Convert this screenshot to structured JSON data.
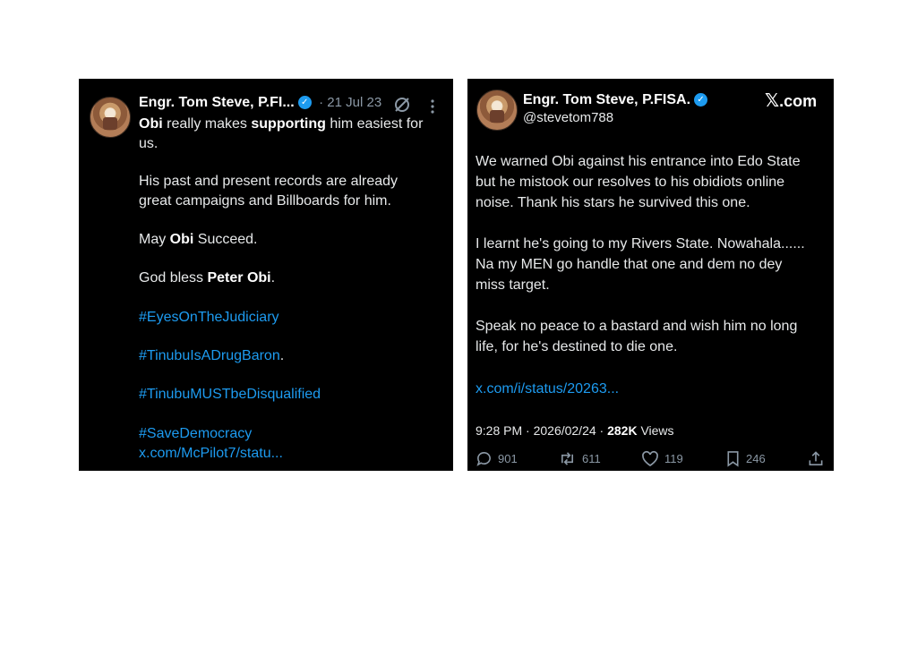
{
  "left_tweet": {
    "name": "Engr. Tom Steve, P.FI...",
    "date": "· 21 Jul 23",
    "line1_a": "Obi",
    "line1_b": " really makes ",
    "line1_c": "supporting",
    "line1_d": " him easiest for",
    "line2": "us.",
    "para2_l1": "His past and present records are already",
    "para2_l2": "great campaigns and Billboards for him.",
    "para3_a": "May ",
    "para3_b": "Obi",
    "para3_c": " Succeed.",
    "para4_a": "God bless ",
    "para4_b": "Peter Obi",
    "para4_c": ".",
    "hashtags": [
      "#EyesOnTheJudiciary",
      "#TinubuIsADrugBaron",
      "#TinubuMUSTbeDisqualified",
      "#SaveDemocracy"
    ],
    "hashtag2_suffix": ".",
    "link": "x.com/McPilot7/statu..."
  },
  "right_tweet": {
    "name": "Engr. Tom Steve, P.FISA.",
    "handle": "@stevetom788",
    "brand_x": "𝕏",
    "brand_text": ".com",
    "p1": [
      "We warned Obi against his entrance into Edo State",
      "but he mistook our resolves to his obidiots online",
      "noise. Thank his stars he survived this one."
    ],
    "p2": [
      "I learnt he's going to my Rivers State. Nowahala......",
      "Na my MEN go handle that one and dem no dey",
      "miss target."
    ],
    "p3": [
      "Speak no peace to a bastard and wish him no long",
      "life, for he's destined to die one."
    ],
    "link": "x.com/i/status/20263...",
    "meta_time": "9:28 PM · 2026/02/24 · ",
    "meta_views_count": "282K",
    "meta_views_label": " Views",
    "replies": "901",
    "reposts": "611",
    "likes": "119",
    "bookmarks": "246"
  },
  "colors": {
    "background": "#000000",
    "text": "#e7e9ea",
    "link": "#1d9bf0",
    "muted": "#8b98a5",
    "verified": "#1d9bf0"
  },
  "icons": [
    "verified-badge-icon",
    "grok-icon",
    "more-icon",
    "x-logo-icon",
    "reply-icon",
    "repost-icon",
    "like-icon",
    "bookmark-icon",
    "share-icon"
  ]
}
